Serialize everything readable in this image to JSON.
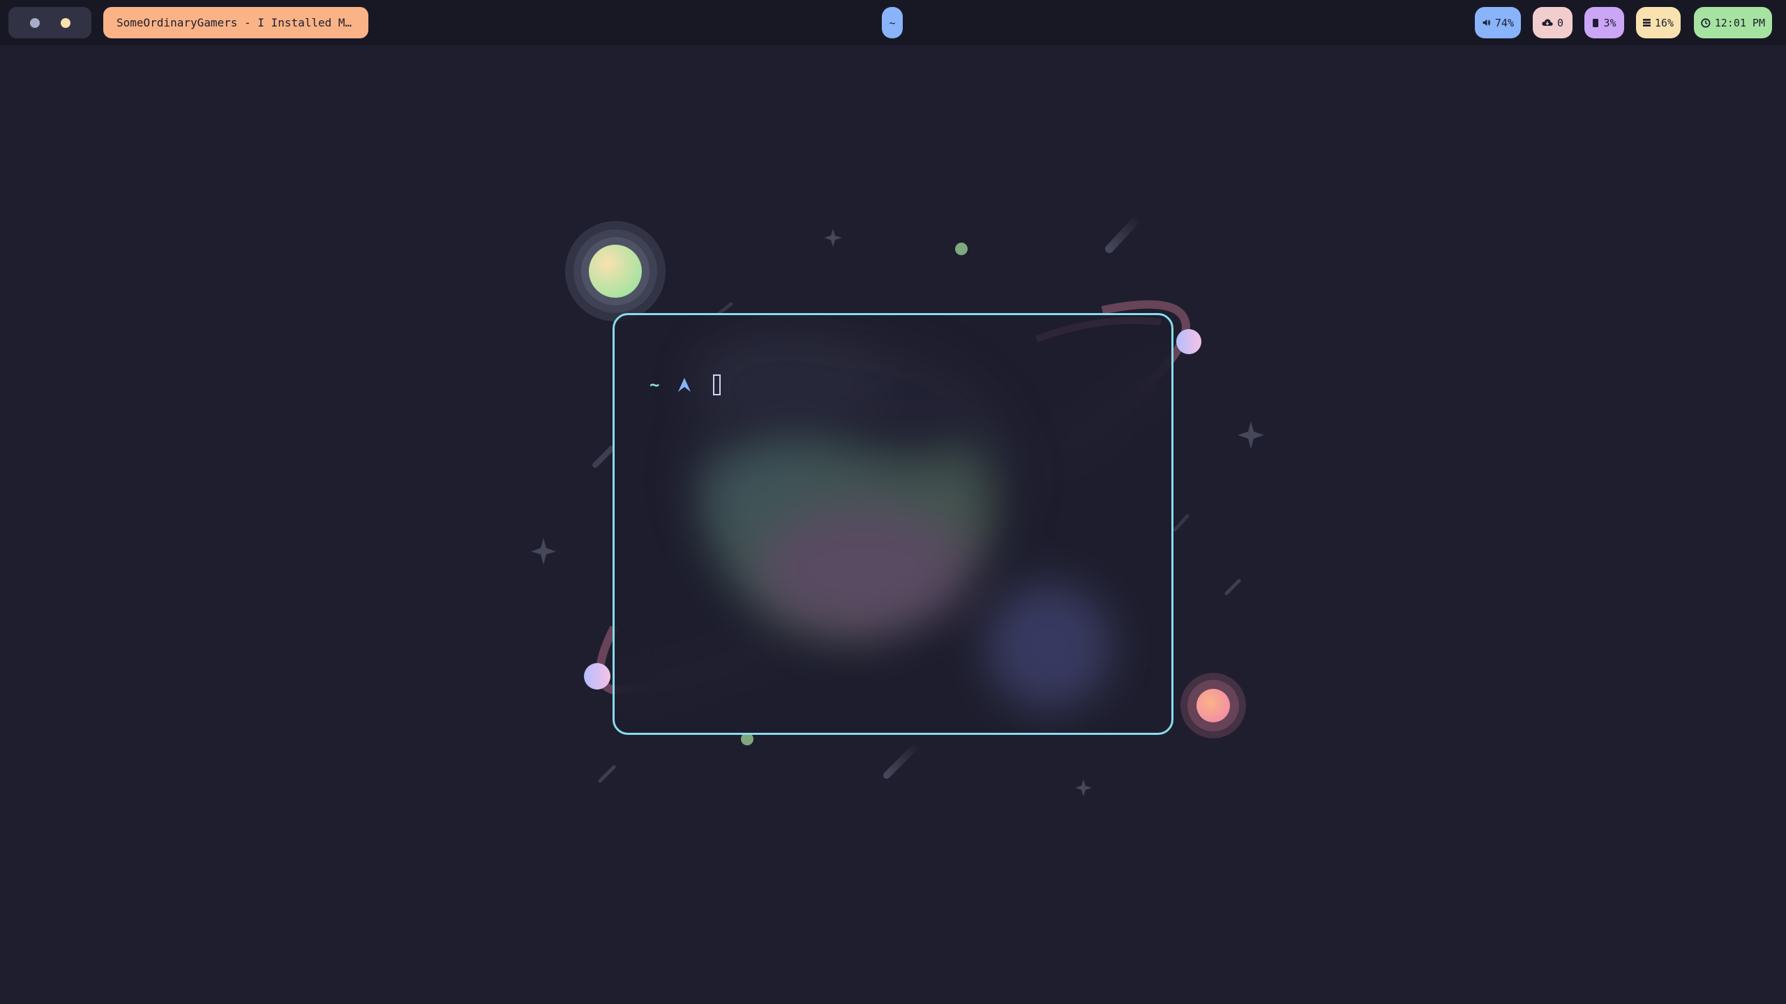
{
  "topbar": {
    "workspaces": [
      {
        "name": "workspace-1",
        "active": false
      },
      {
        "name": "workspace-2",
        "active": true
      }
    ],
    "window_title": "SomeOrdinaryGamers - I Installed Malwa…",
    "center_label": "~",
    "status": {
      "volume": {
        "icon": "speaker-icon",
        "value": "74%"
      },
      "network": {
        "icon": "cloud-download-icon",
        "value": "0"
      },
      "cpu": {
        "icon": "cpu-icon",
        "value": "3%"
      },
      "memory": {
        "icon": "memory-icon",
        "value": "16%"
      },
      "clock": {
        "icon": "clock-icon",
        "value": "12:01 PM"
      }
    }
  },
  "terminal": {
    "prompt_dir": "~",
    "prompt_symbol_icon": "arrow-up-icon",
    "cursor": "block"
  },
  "colors": {
    "background": "#1e1e2e",
    "bar": "#181825",
    "accent_blue": "#89b4fa",
    "accent_peach": "#fab387",
    "accent_pink": "#f2cdcd",
    "accent_mauve": "#cba6f7",
    "accent_yellow": "#f9e2af",
    "accent_green": "#a6e3a1",
    "terminal_border": "#89dceb"
  }
}
